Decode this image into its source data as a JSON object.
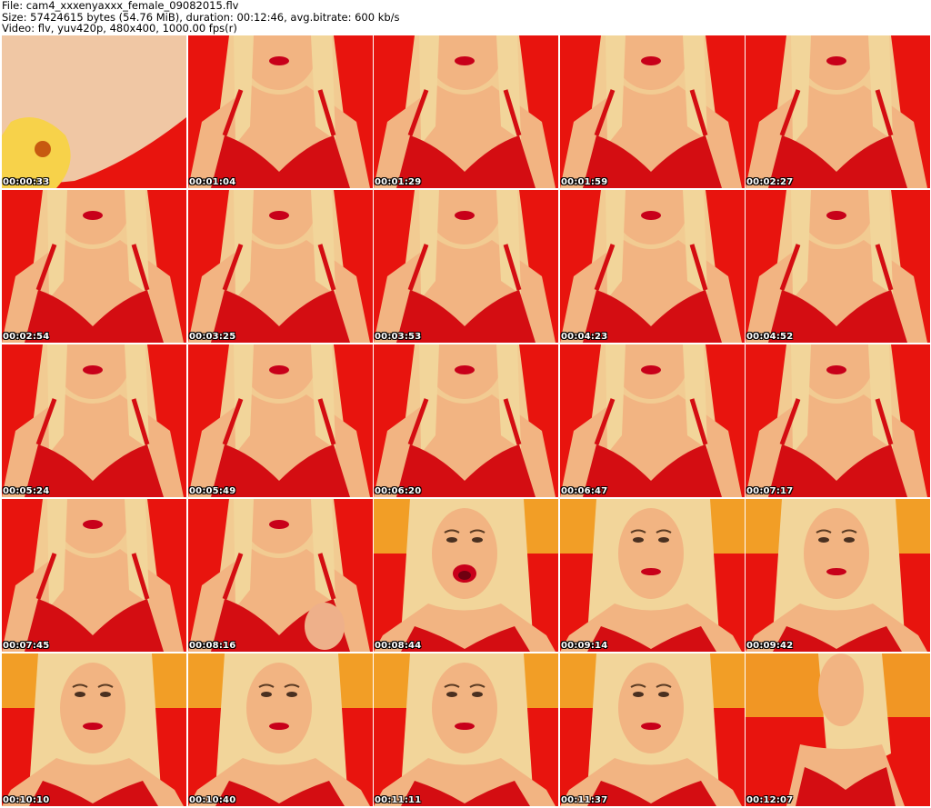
{
  "header": {
    "file_line": "File: cam4_xxxenyaxxx_female_09082015.flv",
    "size_line": "Size: 57424615 bytes (54.76 MiB), duration: 00:12:46, avg.bitrate: 600 kb/s",
    "video_line": "Video: flv, yuv420p, 480x400, 1000.00 fps(r)"
  },
  "thumbnails": [
    {
      "timestamp": "00:00:33",
      "variant": "closeup-skin"
    },
    {
      "timestamp": "00:01:04",
      "variant": "torso-red"
    },
    {
      "timestamp": "00:01:29",
      "variant": "torso-red"
    },
    {
      "timestamp": "00:01:59",
      "variant": "torso-red"
    },
    {
      "timestamp": "00:02:27",
      "variant": "torso-red"
    },
    {
      "timestamp": "00:02:54",
      "variant": "torso-red"
    },
    {
      "timestamp": "00:03:25",
      "variant": "torso-red"
    },
    {
      "timestamp": "00:03:53",
      "variant": "torso-red"
    },
    {
      "timestamp": "00:04:23",
      "variant": "torso-red"
    },
    {
      "timestamp": "00:04:52",
      "variant": "torso-red"
    },
    {
      "timestamp": "00:05:24",
      "variant": "torso-red"
    },
    {
      "timestamp": "00:05:49",
      "variant": "torso-red"
    },
    {
      "timestamp": "00:06:20",
      "variant": "torso-red"
    },
    {
      "timestamp": "00:06:47",
      "variant": "torso-red"
    },
    {
      "timestamp": "00:07:17",
      "variant": "torso-red"
    },
    {
      "timestamp": "00:07:45",
      "variant": "torso-red"
    },
    {
      "timestamp": "00:08:16",
      "variant": "torso-hand"
    },
    {
      "timestamp": "00:08:44",
      "variant": "face-closeup"
    },
    {
      "timestamp": "00:09:14",
      "variant": "face-yellow"
    },
    {
      "timestamp": "00:09:42",
      "variant": "face-yellow"
    },
    {
      "timestamp": "00:10:10",
      "variant": "face-yellow"
    },
    {
      "timestamp": "00:10:40",
      "variant": "face-yellow"
    },
    {
      "timestamp": "00:11:11",
      "variant": "face-yellow"
    },
    {
      "timestamp": "00:11:37",
      "variant": "face-yellow"
    },
    {
      "timestamp": "00:12:07",
      "variant": "profile-yellow"
    }
  ],
  "colors": {
    "background_red": "#e8140e",
    "warm_yellow": "#f3b62a",
    "skin": "#f2b482",
    "hair": "#f2d59a",
    "bra": "#d40d12"
  }
}
